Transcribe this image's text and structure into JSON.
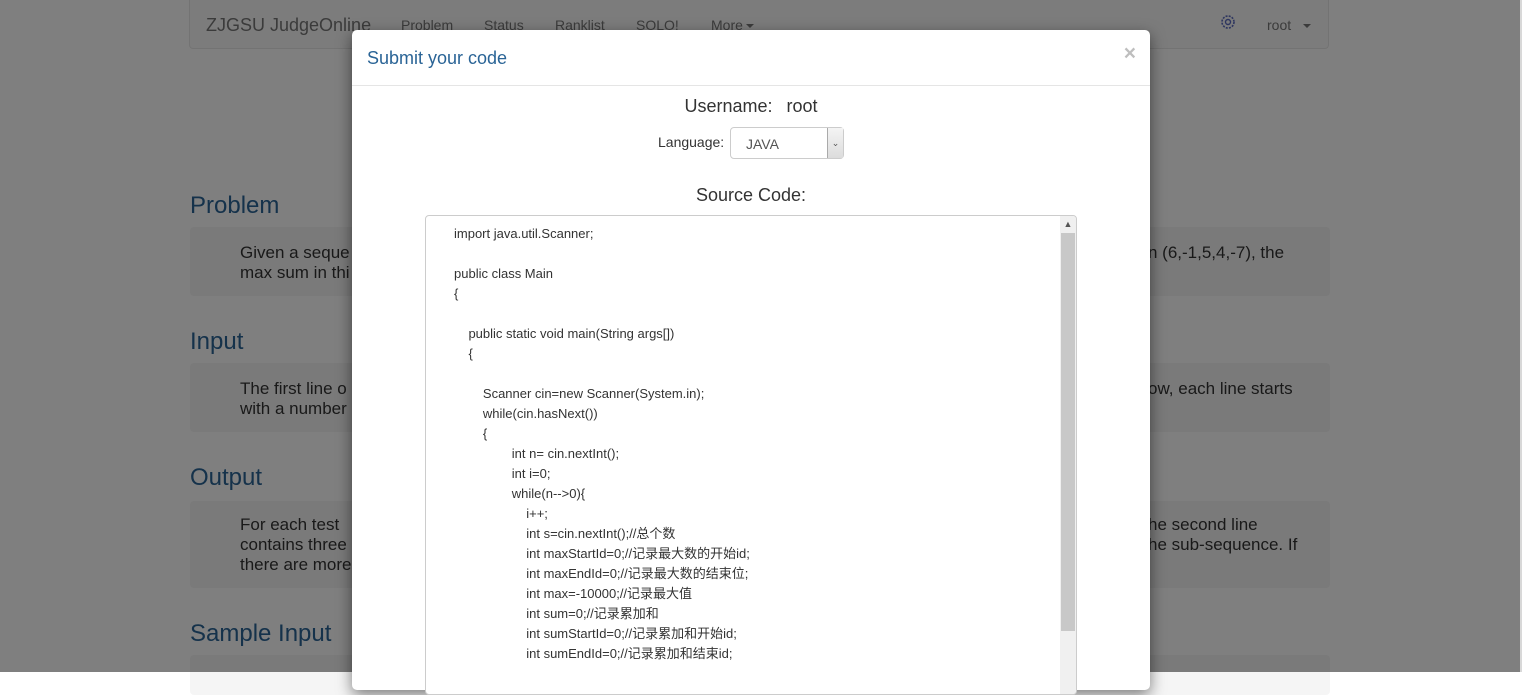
{
  "navbar": {
    "brand": "ZJGSU JudgeOnline",
    "links": [
      "Problem",
      "Status",
      "Ranklist",
      "SOLO!",
      "More"
    ],
    "user": "root",
    "icon": "settings-cog-icon"
  },
  "sections": [
    {
      "title": "Problem",
      "left_lines": [
        "Given a seque",
        "max sum in thi"
      ],
      "right_lines": [
        "n (6,-1,5,4,-7), the",
        ""
      ]
    },
    {
      "title": "Input",
      "left_lines": [
        "The first line o",
        "with a number"
      ],
      "right_lines": [
        "ow, each line starts",
        ""
      ]
    },
    {
      "title": "Output",
      "left_lines": [
        "For each test",
        "contains three",
        "there are more"
      ],
      "right_lines": [
        "he second line",
        "he sub-sequence. If",
        ""
      ]
    },
    {
      "title": "Sample Input",
      "left_lines": [],
      "right_lines": []
    }
  ],
  "modal": {
    "title": "Submit your code",
    "close": "×",
    "username_label": "Username:",
    "username_value": "root",
    "language_label": "Language:",
    "language_value": "JAVA",
    "source_label": "Source Code:",
    "code": "import java.util.Scanner;\n\npublic class Main\n{\n\n    public static void main(String args[])\n    {\n\n        Scanner cin=new Scanner(System.in);\n        while(cin.hasNext())\n        {\n                int n= cin.nextInt();\n                int i=0;\n                while(n-->0){\n                    i++;\n                    int s=cin.nextInt();//总个数\n                    int maxStartId=0;//记录最大数的开始id;\n                    int maxEndId=0;//记录最大数的结束位;\n                    int max=-10000;//记录最大值\n                    int sum=0;//记录累加和\n                    int sumStartId=0;//记录累加和开始id;\n                    int sumEndId=0;//记录累加和结束id;"
  }
}
